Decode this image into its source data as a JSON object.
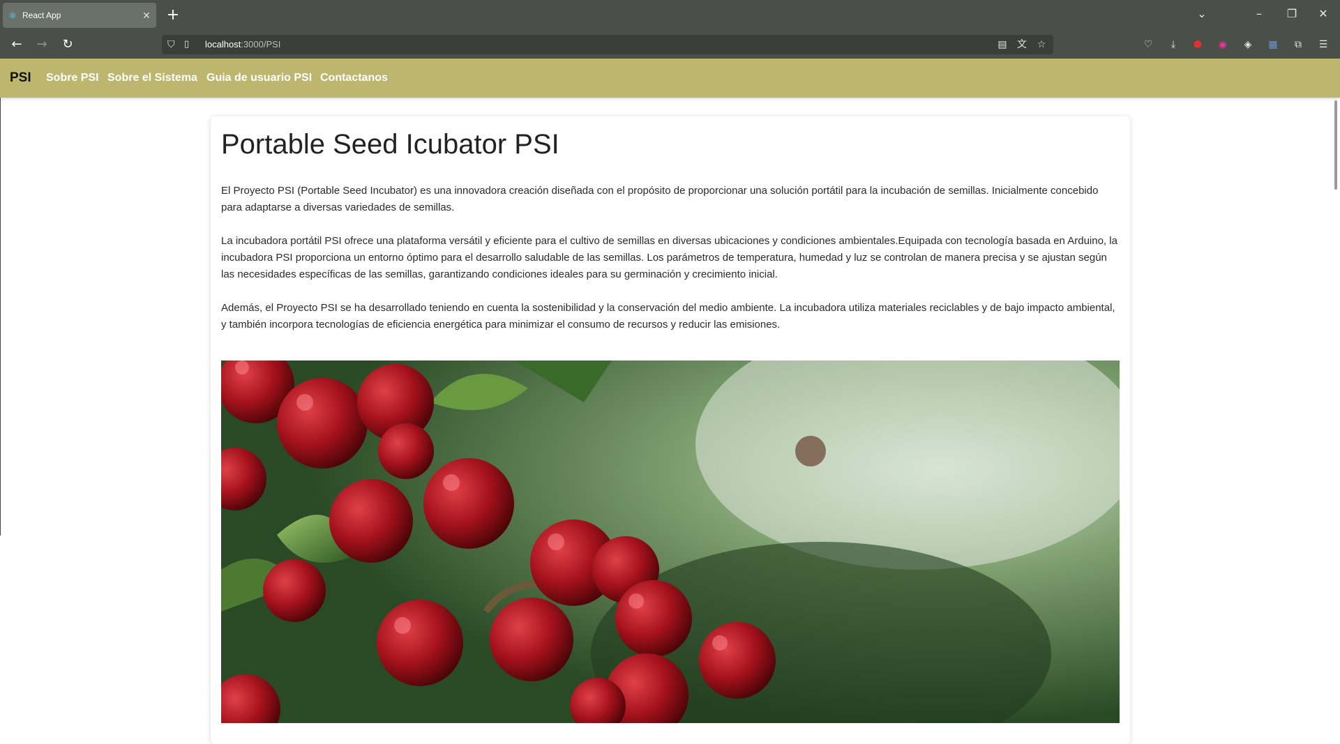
{
  "browser": {
    "tab_title": "React App",
    "new_tab_label": "+",
    "url_host": "localhost",
    "url_rest": ":3000/PSI",
    "icons": [
      "react-favicon",
      "close-icon",
      "plus-icon",
      "chevron-down-icon",
      "minimize-icon",
      "restore-icon",
      "close-window-icon",
      "back-icon",
      "forward-icon",
      "reload-icon",
      "shield-icon",
      "page-icon",
      "reader-view-icon",
      "translate-icon",
      "bookmark-star-icon",
      "pocket-icon",
      "download-icon",
      "ublock-icon",
      "extension-icon",
      "extension-icon",
      "extension-icon",
      "puzzle-icon",
      "menu-icon"
    ]
  },
  "navbar": {
    "brand": "PSI",
    "links": [
      "Sobre PSI",
      "Sobre el Sistema",
      "Guia de usuario PSI",
      "Contactanos"
    ],
    "bg_color": "#bcb66e"
  },
  "main": {
    "title": "Portable Seed Icubator PSI",
    "paragraphs": [
      "El Proyecto PSI (Portable Seed Incubator) es una innovadora creación diseñada con el propósito de proporcionar una solución portátil para la incubación de semillas. Inicialmente concebido para adaptarse a diversas variedades de semillas.",
      "La incubadora portátil PSI ofrece una plataforma versátil y eficiente para el cultivo de semillas en diversas ubicaciones y condiciones ambientales.Equipada con tecnología basada en Arduino, la incubadora PSI proporciona un entorno óptimo para el desarrollo saludable de las semillas. Los parámetros de temperatura, humedad y luz se controlan de manera precisa y se ajustan según las necesidades específicas de las semillas, garantizando condiciones ideales para su germinación y crecimiento inicial.",
      "Además, el Proyecto PSI se ha desarrollado teniendo en cuenta la sostenibilidad y la conservación del medio ambiente. La incubadora utiliza materiales reciclables y de bajo impacto ambiental, y también incorpora tecnologías de eficiencia energética para minimizar el consumo de recursos y reducir las emisiones."
    ]
  }
}
